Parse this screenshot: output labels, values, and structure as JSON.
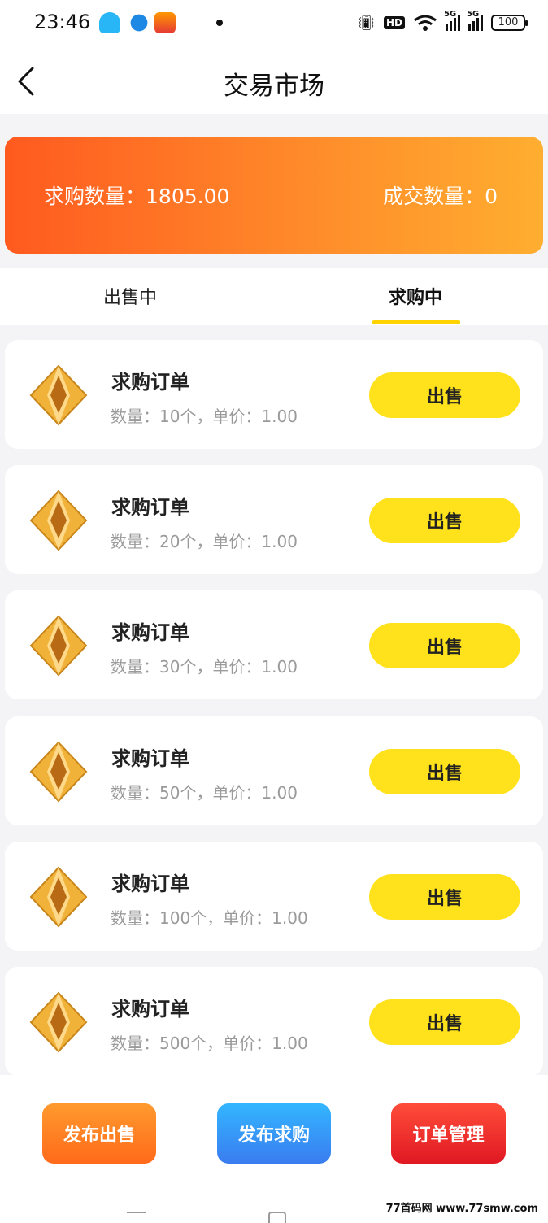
{
  "status_bar": {
    "time": "23:46",
    "hd_label": "HD",
    "network_1": "5G",
    "network_2": "5G",
    "battery": "100"
  },
  "header": {
    "title": "交易市场"
  },
  "summary": {
    "buy_quantity_label": "求购数量：",
    "buy_quantity_value": "1805.00",
    "deal_quantity_label": "成交数量：",
    "deal_quantity_value": "0"
  },
  "tabs": [
    {
      "label": "出售中",
      "active": false
    },
    {
      "label": "求购中",
      "active": true
    }
  ],
  "orders": [
    {
      "title": "求购订单",
      "detail": "数量：10个，单价：1.00",
      "action": "出售"
    },
    {
      "title": "求购订单",
      "detail": "数量：20个，单价：1.00",
      "action": "出售"
    },
    {
      "title": "求购订单",
      "detail": "数量：30个，单价：1.00",
      "action": "出售"
    },
    {
      "title": "求购订单",
      "detail": "数量：50个，单价：1.00",
      "action": "出售"
    },
    {
      "title": "求购订单",
      "detail": "数量：100个，单价：1.00",
      "action": "出售"
    },
    {
      "title": "求购订单",
      "detail": "数量：500个，单价：1.00",
      "action": "出售"
    }
  ],
  "bottom_actions": {
    "publish_sell": "发布出售",
    "publish_buy": "发布求购",
    "order_management": "订单管理"
  },
  "watermark": "77首码网 www.77smw.com",
  "colors": {
    "banner_start": "#ff5a1f",
    "banner_end": "#ffae30",
    "sell_button": "#ffe21c",
    "tab_indicator": "#ffd200",
    "publish_buy": "#3a7cf0",
    "order_management": "#e01822"
  }
}
